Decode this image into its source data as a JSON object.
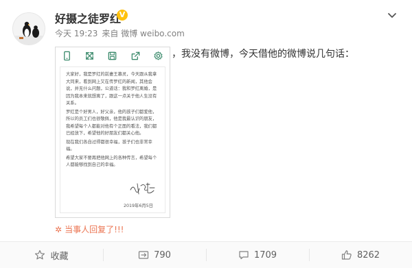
{
  "post": {
    "username": "好摄之徒罗红",
    "verified_badge": "V",
    "time": "今天 19:23",
    "source": "来自 微博 weibo.com",
    "text_lead": "“",
    "text": "，我没有微博，今天借他的微博说几句话："
  },
  "image_toolbar": [
    {
      "icon": "phone-icon"
    },
    {
      "icon": "expand-icon"
    },
    {
      "icon": "save-icon"
    },
    {
      "icon": "share-icon"
    },
    {
      "icon": "settings-icon"
    }
  ],
  "document": {
    "paragraphs": [
      "大家好，我是罗红的前妻王慕灵，今天跟从我拿大同来，看到网上又在传罗红的新闻，其他会说，并无什么问题，公道话：我和罗红离婚，是因为我本来就想离了，跟这一点关于他人生没有关系。",
      "罗红是个好男人，好父亲，他的孩子们都爱他，所以的员工们也很敬佩，他是我最认识的朋友，我希望每个人都能对他有个正面的看法，我们都已经放下，希望他的好朋友们都关心他。",
      "现在我们各自过得都很幸福，孩子们也非常幸福。",
      "希望大家不要再把他网上的各种传言，希望每个人都能够找到自己的幸福。"
    ],
    "date": "2019年6月5日"
  },
  "reply_tag": "当事人回复了!!!",
  "actions": {
    "favorite": "收藏",
    "forward_count": "790",
    "comment_count": "1709",
    "like_count": "8262"
  },
  "colors": {
    "accent": "#eb7350",
    "badge": "#ffc20e",
    "text": "#333333",
    "muted": "#808080"
  }
}
